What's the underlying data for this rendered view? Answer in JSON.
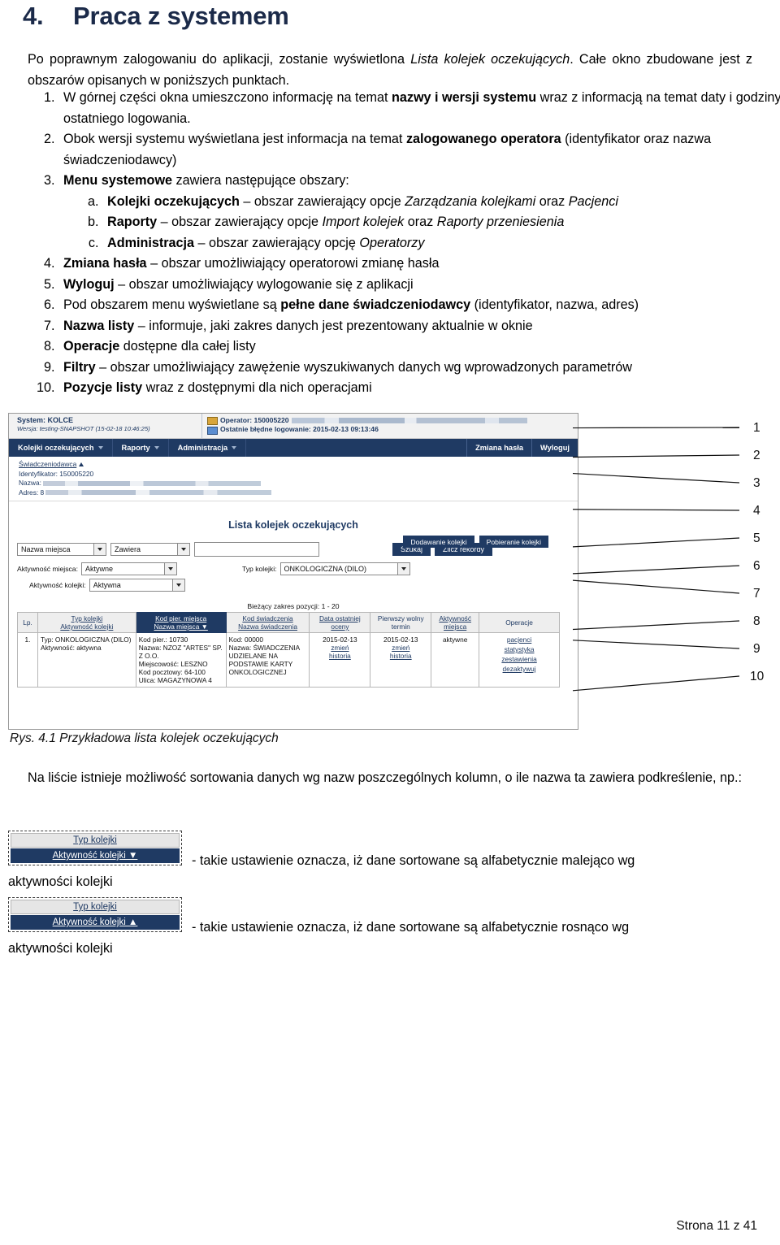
{
  "heading": {
    "number": "4.",
    "title": "Praca z systemem"
  },
  "intro": {
    "p1_a": "Po poprawnym zalogowaniu do aplikacji, zostanie wyświetlona ",
    "p1_i": "Lista kolejek oczekujących",
    "p1_b": ". Całe okno zbudowane jest z obszarów opisanych w poniższych punktach."
  },
  "list": [
    {
      "bold": "",
      "text_a": "W górnej części okna umieszczono informację na temat ",
      "bold_mid": "nazwy i wersji systemu",
      "text_b": " wraz z informacją na temat daty i godziny ostatniego logowania."
    },
    {
      "text_a": "Obok wersji systemu wyświetlana jest informacja na temat ",
      "bold_mid": "zalogowanego operatora",
      "text_b": " (identyfikator oraz nazwa świadczeniodawcy)"
    },
    {
      "bold_lead": "Menu systemowe",
      "text_b": " zawiera następujące obszary:"
    },
    {
      "bold_lead": "Zmiana hasła",
      "text_b": " – obszar umożliwiający operatorowi zmianę hasła"
    },
    {
      "bold_lead": "Wyloguj",
      "text_b": " – obszar umożliwiający wylogowanie się z aplikacji"
    },
    {
      "text_a": "Pod obszarem menu wyświetlane są ",
      "bold_mid": "pełne dane świadczeniodawcy",
      "text_b": " (identyfikator, nazwa, adres)"
    },
    {
      "bold_lead": "Nazwa listy",
      "text_b": " – informuje, jaki zakres danych jest prezentowany aktualnie w oknie"
    },
    {
      "bold_lead": "Operacje",
      "text_b": " dostępne dla całej listy"
    },
    {
      "bold_lead": "Filtry",
      "text_b": " – obszar umożliwiający zawężenie wyszukiwanych danych wg wprowadzonych parametrów"
    },
    {
      "bold_lead": "Pozycje listy",
      "text_b": " wraz z dostępnymi dla nich operacjami"
    }
  ],
  "sublist": [
    {
      "bold_lead": "Kolejki oczekujących",
      "text_a": " – obszar zawierający opcje ",
      "italic_a": "Zarządzania kolejkami",
      "text_b": " oraz ",
      "italic_b": "Pacjenci"
    },
    {
      "bold_lead": "Raporty",
      "text_a": " – obszar zawierający opcje ",
      "italic_a": "Import kolejek",
      "text_b": " oraz ",
      "italic_b": "Raporty przeniesienia"
    },
    {
      "bold_lead": "Administracja",
      "text_a": " – obszar zawierający opcję ",
      "italic_a": "Operatorzy",
      "text_b": "",
      "italic_b": ""
    }
  ],
  "app": {
    "system_label": "System: KOLCE",
    "version_label": "Wersja: testing-SNAPSHOT (15-02-18 10:46:25)",
    "operator_label": "Operator: 150005220",
    "last_failed_login_label": "Ostatnie błędne logowanie: 2015-02-13 09:13:46",
    "menu": [
      {
        "label": "Kolejki oczekujących"
      },
      {
        "label": "Raporty"
      },
      {
        "label": "Administracja"
      }
    ],
    "menu_right": [
      {
        "label": "Zmiana hasła"
      },
      {
        "label": "Wyloguj"
      }
    ],
    "provider": {
      "title": "Świadczeniodawca",
      "identifier_label": "Identyfikator: 150005220",
      "name_label": "Nazwa:",
      "address_label": "Adres: 8"
    },
    "list_title": "Lista kolejek oczekujących",
    "filters": {
      "field_select": "Nazwa miejsca",
      "operator_select": "Zawiera",
      "value_input": "",
      "search_button": "Szukaj",
      "count_button": "Zlicz rekordy",
      "place_activity_label": "Aktywność miejsca:",
      "place_activity_value": "Aktywne",
      "queue_activity_label": "Aktywność kolejki:",
      "queue_activity_value": "Aktywna",
      "queue_type_label": "Typ kolejki:",
      "queue_type_value": "ONKOLOGICZNA (DILO)"
    },
    "operations": {
      "add_queue": "Dodawanie kolejki",
      "download_queue": "Pobieranie kolejki"
    },
    "range_label": "Bieżący zakres pozycji: 1 - 20",
    "table": {
      "headers": [
        {
          "line1": "Lp.",
          "line2": ""
        },
        {
          "line1": "Typ kolejki",
          "line2": "Aktywność kolejki"
        },
        {
          "line1": "Kod pier. miejsca",
          "line2": "Nazwa miejsca ▼",
          "selected": true
        },
        {
          "line1": "Kod świadczenia",
          "line2": "Nazwa świadczenia"
        },
        {
          "line1": "Data ostatniej",
          "line2": "oceny"
        },
        {
          "line1": "Pierwszy wolny",
          "line2": "termin"
        },
        {
          "line1": "Aktywność",
          "line2": "miejsca"
        },
        {
          "line1": "Operacje",
          "line2": ""
        }
      ],
      "rows": [
        {
          "lp": "1.",
          "queue": [
            "Typ: ONKOLOGICZNA (DILO)",
            "Aktywność: aktywna"
          ],
          "place": [
            "Kod pier.: 10730",
            "Nazwa: NZOZ \"ARTES\" SP. Z O.O.",
            "Miejscowość: LESZNO",
            "Kod pocztowy: 64-100",
            "Ulica: MAGAZYNOWA 4"
          ],
          "service": [
            "Kod: 00000",
            "Nazwa: ŚWIADCZENIA UDZIELANE NA PODSTAWIE KARTY ONKOLOGICZNEJ"
          ],
          "last_eval_date": "2015-02-13",
          "last_eval_links": [
            "zmień",
            "historia"
          ],
          "first_free_date": "2015-02-13",
          "first_free_links": [
            "zmień",
            "historia"
          ],
          "place_activity": "aktywne",
          "operations": [
            "pacjenci",
            "statystyka",
            "zestawienia",
            "dezaktywuj"
          ]
        }
      ]
    }
  },
  "callouts": [
    "1",
    "2",
    "3",
    "4",
    "5",
    "6",
    "7",
    "8",
    "9",
    "10"
  ],
  "figure_caption": "Rys. 4.1 Przykładowa lista kolejek oczekujących",
  "sorting": {
    "intro": "Na liście istnieje możliwość sortowania danych wg nazw poszczególnych kolumn, o ile nazwa ta zawiera podkreślenie, np.:",
    "desc_box": {
      "row1": "Typ kolejki",
      "row2": "Aktywność kolejki ▼"
    },
    "desc_text": "- takie ustawienie oznacza, iż dane sortowane są alfabetycznie malejąco wg",
    "desc_tail": "aktywności kolejki",
    "asc_box": {
      "row1": "Typ kolejki",
      "row2": "Aktywność kolejki ▲"
    },
    "asc_text": "- takie ustawienie oznacza, iż dane sortowane są alfabetycznie rosnąco wg",
    "asc_tail": "aktywności kolejki"
  },
  "footer": {
    "page_label": "Strona 11 z 41"
  }
}
